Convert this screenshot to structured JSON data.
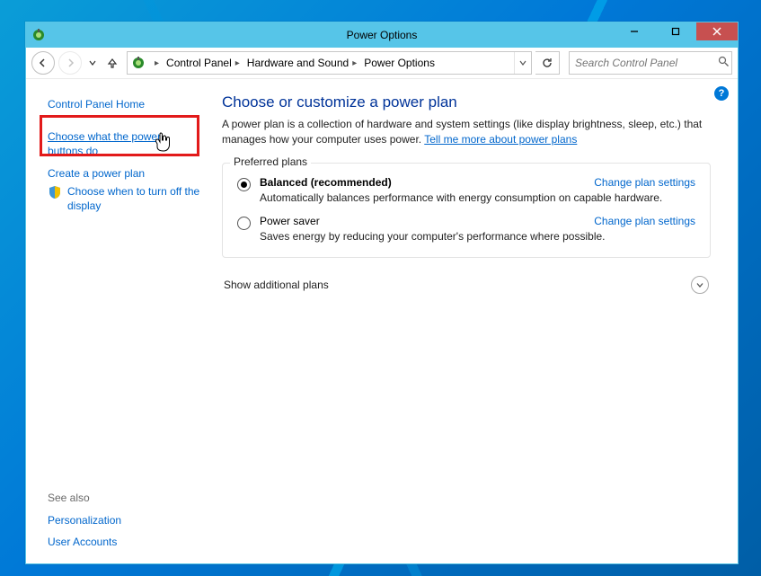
{
  "window": {
    "title": "Power Options"
  },
  "breadcrumbs": {
    "items": [
      "Control Panel",
      "Hardware and Sound",
      "Power Options"
    ]
  },
  "search": {
    "placeholder": "Search Control Panel"
  },
  "sidebar": {
    "home": "Control Panel Home",
    "links": [
      "Choose what the power buttons do",
      "Create a power plan",
      "Choose when to turn off the display"
    ],
    "see_also_label": "See also",
    "see_also": [
      "Personalization",
      "User Accounts"
    ]
  },
  "main": {
    "heading": "Choose or customize a power plan",
    "description_prefix": "A power plan is a collection of hardware and system settings (like display brightness, sleep, etc.) that manages how your computer uses power. ",
    "description_link": "Tell me more about power plans",
    "preferred_label": "Preferred plans",
    "change_settings_label": "Change plan settings",
    "plans": [
      {
        "name": "Balanced (recommended)",
        "desc": "Automatically balances performance with energy consumption on capable hardware.",
        "checked": true
      },
      {
        "name": "Power saver",
        "desc": "Saves energy by reducing your computer's performance where possible.",
        "checked": false
      }
    ],
    "expander_label": "Show additional plans"
  },
  "help_glyph": "?"
}
